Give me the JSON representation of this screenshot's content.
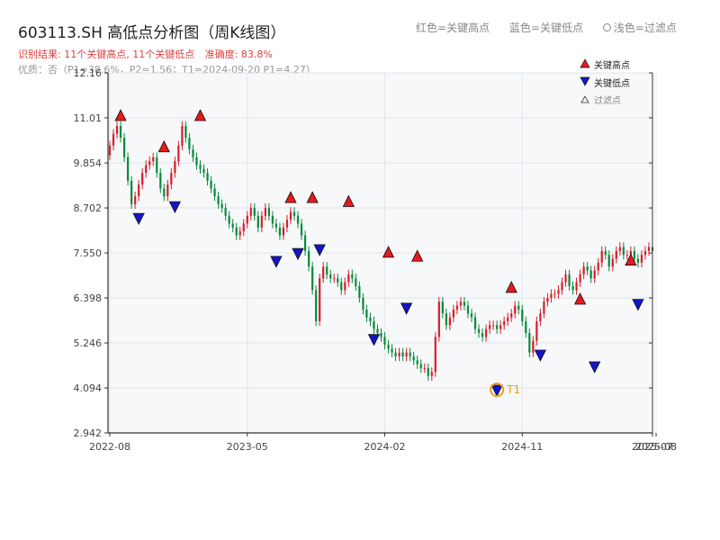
{
  "header": {
    "title": "603113.SH 高低点分析图（周K线图）",
    "result_text": "识别结果: 11个关键高点, 11个关键低点",
    "accuracy_text": "准确度: 83.8%",
    "quality_text": "优质：否（P1=38.6%，P2=1.56；T1=2024-09-20 P1=4.27）"
  },
  "top_legend": {
    "red": "红色=关键高点",
    "blue": "蓝色=关键低点",
    "light": "浅色=过滤点"
  },
  "colors": {
    "up": "#d81e2a",
    "down": "#0a8a3a",
    "high_marker": "#e41a1c",
    "low_marker": "#1515c8",
    "t1": "#f39c12",
    "plot_bg": "#f6f8fa",
    "grid": "#e3e6ea",
    "axis": "#333333"
  },
  "chart_data": {
    "type": "candlestick",
    "y_range": [
      2.942,
      12.16
    ],
    "y_ticks": [
      "2.942",
      "4.094",
      "5.246",
      "6.398",
      "7.550",
      "8.702",
      "9.854",
      "11.01",
      "12.16"
    ],
    "x_ticks": [
      "2022-08",
      "2023-05",
      "2024-02",
      "2024-11",
      "2025-07",
      "2025-08"
    ],
    "x_tick_positions": [
      0,
      38,
      76,
      114,
      150,
      151
    ],
    "legend": {
      "high": "关键高点",
      "low": "关键低点",
      "filtered": "过滤点"
    },
    "t1_label": "T1",
    "t1_index": 107,
    "closes": [
      10.3,
      10.6,
      10.8,
      10.5,
      10.0,
      9.4,
      8.8,
      9.0,
      9.3,
      9.6,
      9.8,
      9.9,
      10.0,
      9.6,
      9.2,
      9.0,
      9.3,
      9.6,
      9.9,
      10.3,
      10.8,
      10.5,
      10.2,
      10.0,
      9.8,
      9.7,
      9.6,
      9.4,
      9.2,
      9.0,
      8.8,
      8.7,
      8.5,
      8.3,
      8.2,
      8.0,
      8.1,
      8.3,
      8.5,
      8.7,
      8.5,
      8.2,
      8.5,
      8.7,
      8.5,
      8.3,
      8.2,
      8.0,
      8.2,
      8.4,
      8.6,
      8.5,
      8.3,
      8.0,
      7.6,
      7.2,
      6.6,
      5.8,
      6.9,
      7.2,
      7.0,
      6.9,
      6.9,
      6.8,
      6.6,
      6.8,
      7.0,
      6.9,
      6.7,
      6.4,
      6.1,
      5.9,
      5.8,
      5.6,
      5.5,
      5.4,
      5.2,
      5.1,
      5.0,
      4.9,
      5.0,
      4.9,
      5.0,
      4.9,
      4.8,
      4.7,
      4.6,
      4.6,
      4.4,
      4.5,
      5.4,
      6.3,
      6.0,
      5.7,
      5.9,
      6.1,
      6.2,
      6.3,
      6.2,
      6.0,
      5.9,
      5.6,
      5.5,
      5.4,
      5.6,
      5.7,
      5.7,
      5.6,
      5.7,
      5.8,
      5.9,
      6.0,
      6.2,
      6.1,
      5.8,
      5.5,
      5.0,
      5.3,
      5.8,
      6.0,
      6.3,
      6.4,
      6.5,
      6.5,
      6.6,
      6.8,
      7.0,
      6.7,
      6.6,
      6.8,
      7.0,
      7.2,
      7.1,
      6.9,
      7.1,
      7.3,
      7.6,
      7.5,
      7.2,
      7.4,
      7.6,
      7.7,
      7.5,
      7.5,
      7.6,
      7.4,
      7.3,
      7.5,
      7.6,
      7.7,
      7.6
    ],
    "highs": [
      {
        "i": 3,
        "price": 10.8
      },
      {
        "i": 15,
        "price": 10.0
      },
      {
        "i": 25,
        "price": 10.8
      },
      {
        "i": 50,
        "price": 8.7
      },
      {
        "i": 56,
        "price": 8.7
      },
      {
        "i": 66,
        "price": 8.6
      },
      {
        "i": 77,
        "price": 7.3
      },
      {
        "i": 85,
        "price": 7.2
      },
      {
        "i": 111,
        "price": 6.4
      },
      {
        "i": 130,
        "price": 6.1
      },
      {
        "i": 144,
        "price": 7.1
      }
    ],
    "lows": [
      {
        "i": 8,
        "price": 8.7
      },
      {
        "i": 18,
        "price": 9.0
      },
      {
        "i": 46,
        "price": 7.6
      },
      {
        "i": 52,
        "price": 7.8
      },
      {
        "i": 58,
        "price": 7.9
      },
      {
        "i": 73,
        "price": 5.6
      },
      {
        "i": 82,
        "price": 6.4
      },
      {
        "i": 107,
        "price": 4.3
      },
      {
        "i": 119,
        "price": 5.2
      },
      {
        "i": 134,
        "price": 4.9
      },
      {
        "i": 146,
        "price": 6.5
      }
    ]
  }
}
